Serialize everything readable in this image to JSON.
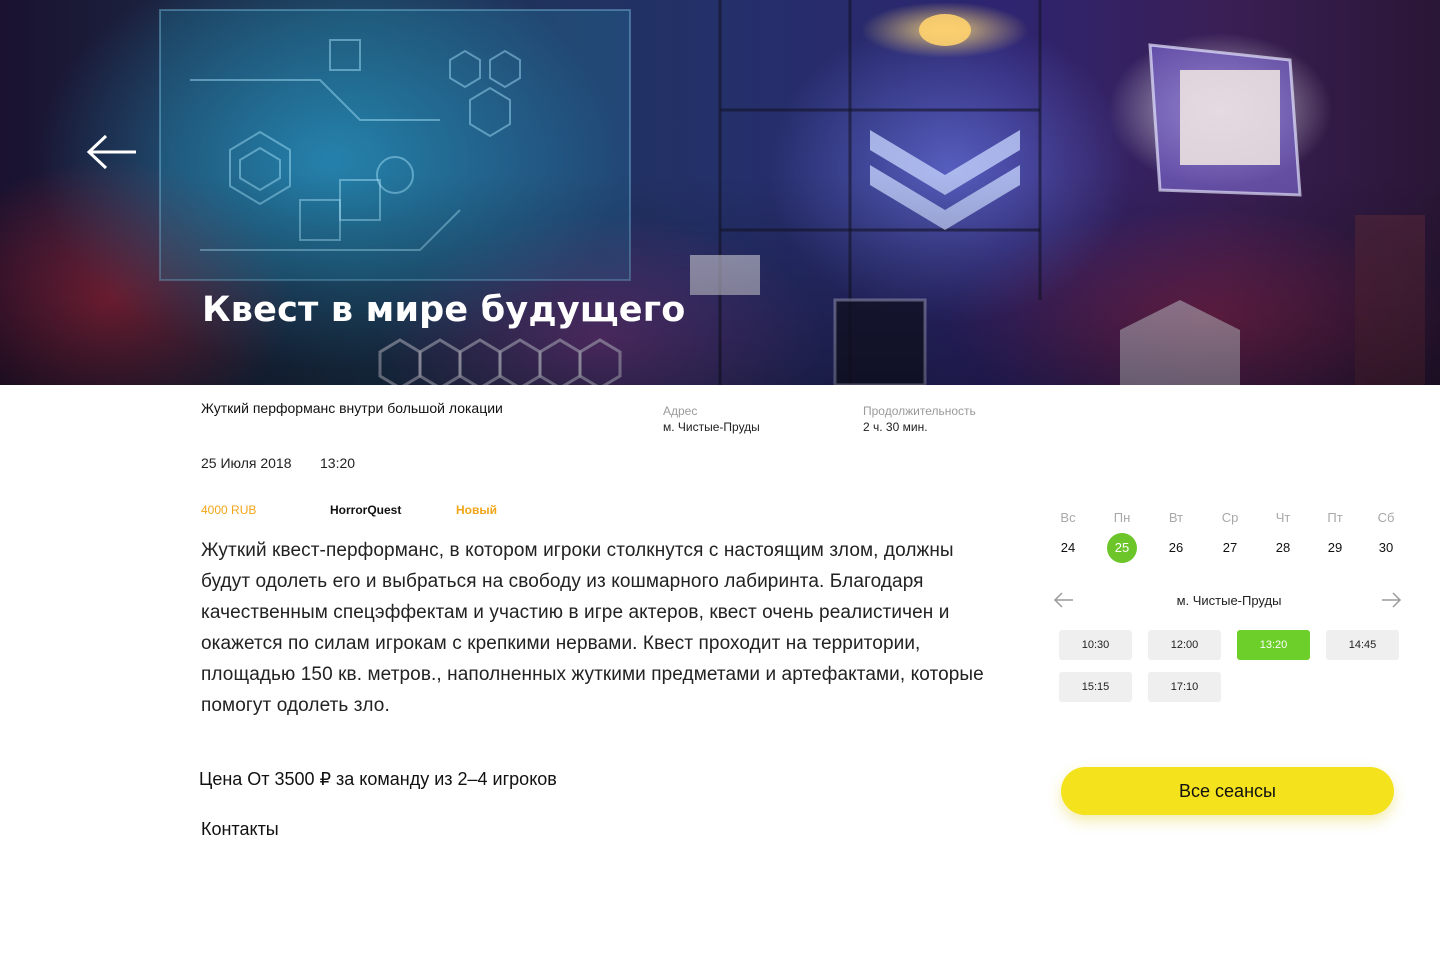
{
  "hero": {
    "title": "Квест в мире будущего",
    "back_icon": "arrow-left-icon"
  },
  "info": {
    "subtitle": "Жуткий перформанс внутри большой локации",
    "address_label": "Адрес",
    "address_value": "м. Чистые-Пруды",
    "duration_label": "Продолжительность",
    "duration_value": "2 ч.  30 мин.",
    "date": "25 Июля 2018",
    "time": "13:20",
    "price_tag": "4000 RUB",
    "organizer": "HorrorQuest",
    "badge": "Новый"
  },
  "description": "Жуткий квест-перформанс, в котором игроки столкнутся с настоящим злом, должны будут одолеть его и выбраться на свободу из кошмарного лабиринта. Благодаря качественным спецэффектам и участию в игре актеров, квест очень реалистичен и окажется по силам игрокам с крепкими нервами. Квест проходит на территории, площадью 150 кв. метров., наполненных жуткими предметами и артефактами, которые помогут одолеть зло.",
  "price_line": "Цена От 3500 ₽ за команду из 2–4 игроков",
  "contacts_label": "Контакты",
  "calendar": {
    "days": [
      {
        "name": "Вс",
        "num": "24"
      },
      {
        "name": "Пн",
        "num": "25",
        "active": true
      },
      {
        "name": "Вт",
        "num": "26"
      },
      {
        "name": "Ср",
        "num": "27"
      },
      {
        "name": "Чт",
        "num": "28"
      },
      {
        "name": "Пт",
        "num": "29"
      },
      {
        "name": "Сб",
        "num": "30"
      }
    ],
    "location": "м. Чистые-Пруды",
    "prev_icon": "arrow-left-icon",
    "next_icon": "arrow-right-icon",
    "slots": [
      {
        "time": "10:30"
      },
      {
        "time": "12:00"
      },
      {
        "time": "13:20",
        "active": true
      },
      {
        "time": "14:45"
      },
      {
        "time": "15:15"
      },
      {
        "time": "17:10"
      }
    ],
    "all_sessions_label": "Все сеансы"
  },
  "colors": {
    "accent_green": "#6cc62a",
    "accent_yellow": "#f4e21d",
    "accent_orange": "#f2a518"
  }
}
